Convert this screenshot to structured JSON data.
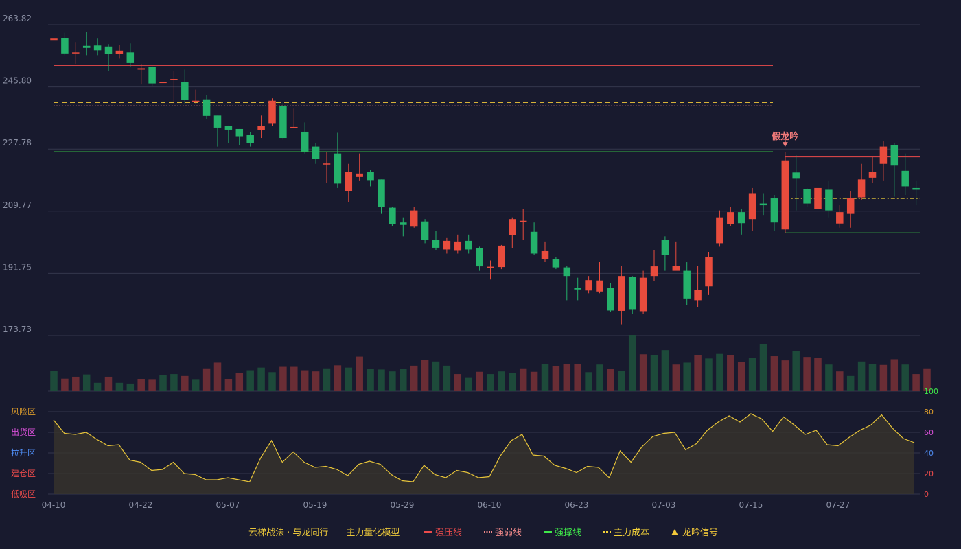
{
  "chart_data": {
    "type": "candlestick",
    "price_axis": {
      "ticks": [
        263.82,
        245.8,
        227.78,
        209.77,
        191.75,
        173.73
      ],
      "range": [
        173.73,
        263.82
      ]
    },
    "date_ticks": [
      "04-10",
      "04-22",
      "05-07",
      "05-19",
      "05-29",
      "06-10",
      "06-23",
      "07-03",
      "07-15",
      "07-27"
    ],
    "date_tick_index": [
      0,
      8,
      16,
      24,
      32,
      40,
      48,
      56,
      64,
      72
    ],
    "candles": [
      [
        259.8,
        259.2,
        260.6,
        255.1,
        "up"
      ],
      [
        260.0,
        255.5,
        261.5,
        255.0,
        "down"
      ],
      [
        255.8,
        255.6,
        258.8,
        252.5,
        "up"
      ],
      [
        257.1,
        257.7,
        261.8,
        255.0,
        "down"
      ],
      [
        257.8,
        256.4,
        259.8,
        255.0,
        "down"
      ],
      [
        257.5,
        255.4,
        258.2,
        250.5,
        "down"
      ],
      [
        256.3,
        255.4,
        258.0,
        254.0,
        "up"
      ],
      [
        255.8,
        252.7,
        258.4,
        251.6,
        "down"
      ],
      [
        251.2,
        250.8,
        252.5,
        246.5,
        "up"
      ],
      [
        251.5,
        246.8,
        251.8,
        245.9,
        "down"
      ],
      [
        247.1,
        247.2,
        251.0,
        243.2,
        "up"
      ],
      [
        248.1,
        248.0,
        250.5,
        241.0,
        "up"
      ],
      [
        247.2,
        242.0,
        250.8,
        241.0,
        "down"
      ],
      [
        241.5,
        241.8,
        245.0,
        241.0,
        "up"
      ],
      [
        242.2,
        237.4,
        243.5,
        236.5,
        "down"
      ],
      [
        237.5,
        234.0,
        237.5,
        228.5,
        "down"
      ],
      [
        234.4,
        233.4,
        234.6,
        229.5,
        "down"
      ],
      [
        233.6,
        231.5,
        233.6,
        229.0,
        "down"
      ],
      [
        231.8,
        229.6,
        232.8,
        228.5,
        "down"
      ],
      [
        233.2,
        234.4,
        237.5,
        231.0,
        "up"
      ],
      [
        235.3,
        241.8,
        242.5,
        234.5,
        "up"
      ],
      [
        240.2,
        231.0,
        241.5,
        230.5,
        "down"
      ],
      [
        234.2,
        234.0,
        239.5,
        234.0,
        "up"
      ],
      [
        232.8,
        227.1,
        235.5,
        226.5,
        "down"
      ],
      [
        228.5,
        225.0,
        229.5,
        223.5,
        "down"
      ],
      [
        223.4,
        223.6,
        227.0,
        218.0,
        "up"
      ],
      [
        226.5,
        217.8,
        232.5,
        216.5,
        "down"
      ],
      [
        215.5,
        221.2,
        223.5,
        212.5,
        "up"
      ],
      [
        220.7,
        219.7,
        226.5,
        218.5,
        "up"
      ],
      [
        221.2,
        218.6,
        221.8,
        217.0,
        "down"
      ],
      [
        219.0,
        211.0,
        219.0,
        209.0,
        "down"
      ],
      [
        210.8,
        206.0,
        211.0,
        205.5,
        "down"
      ],
      [
        206.5,
        205.8,
        208.0,
        202.5,
        "down"
      ],
      [
        205.3,
        210.0,
        211.0,
        205.0,
        "up"
      ],
      [
        206.8,
        201.5,
        207.5,
        200.5,
        "down"
      ],
      [
        201.5,
        199.2,
        204.0,
        198.5,
        "down"
      ],
      [
        201.2,
        198.7,
        202.0,
        197.5,
        "up"
      ],
      [
        198.3,
        201.0,
        203.0,
        197.5,
        "up"
      ],
      [
        201.2,
        198.7,
        203.0,
        197.5,
        "down"
      ],
      [
        199.0,
        193.8,
        199.5,
        192.5,
        "down"
      ],
      [
        193.7,
        193.3,
        195.5,
        190.0,
        "up"
      ],
      [
        193.6,
        199.8,
        200.0,
        193.0,
        "up"
      ],
      [
        202.8,
        207.5,
        208.0,
        199.0,
        "up"
      ],
      [
        207.0,
        207.0,
        210.5,
        201.5,
        "up"
      ],
      [
        203.8,
        197.5,
        206.5,
        197.0,
        "down"
      ],
      [
        196.0,
        198.2,
        201.0,
        195.0,
        "up"
      ],
      [
        195.8,
        193.5,
        196.5,
        193.0,
        "down"
      ],
      [
        193.5,
        191.0,
        194.0,
        184.0,
        "down"
      ],
      [
        187.1,
        187.5,
        190.5,
        184.0,
        "down"
      ],
      [
        186.8,
        189.8,
        191.0,
        186.0,
        "up"
      ],
      [
        189.7,
        186.5,
        195.0,
        186.0,
        "up"
      ],
      [
        181.0,
        187.5,
        189.0,
        180.5,
        "down"
      ],
      [
        180.9,
        191.0,
        194.0,
        177.0,
        "up"
      ],
      [
        190.8,
        181.2,
        191.0,
        180.0,
        "down"
      ],
      [
        180.8,
        190.5,
        192.5,
        180.0,
        "up"
      ],
      [
        191.0,
        193.8,
        198.5,
        189.5,
        "up"
      ],
      [
        197.0,
        201.5,
        202.5,
        192.5,
        "down"
      ],
      [
        192.5,
        194.0,
        201.0,
        193.0,
        "up"
      ],
      [
        192.5,
        184.5,
        195.0,
        182.5,
        "down"
      ],
      [
        184.0,
        187.0,
        194.0,
        182.0,
        "up"
      ],
      [
        188.0,
        196.5,
        198.0,
        185.5,
        "up"
      ],
      [
        200.5,
        208.0,
        210.0,
        199.5,
        "up"
      ],
      [
        206.0,
        209.5,
        211.0,
        205.5,
        "up"
      ],
      [
        206.3,
        209.5,
        210.5,
        203.0,
        "down"
      ],
      [
        207.5,
        215.0,
        216.5,
        204.0,
        "up"
      ],
      [
        211.5,
        212.0,
        215.0,
        208.5,
        "down"
      ],
      [
        206.5,
        213.5,
        214.5,
        204.0,
        "down"
      ],
      [
        204.5,
        224.5,
        227.0,
        203.5,
        "up"
      ],
      [
        221.0,
        219.2,
        226.0,
        210.0,
        "down"
      ],
      [
        216.2,
        212.0,
        216.5,
        211.0,
        "down"
      ],
      [
        210.5,
        216.5,
        220.5,
        205.5,
        "up"
      ],
      [
        216.0,
        210.0,
        218.5,
        208.0,
        "down"
      ],
      [
        209.5,
        206.2,
        211.5,
        205.0,
        "up"
      ],
      [
        209.0,
        213.5,
        215.5,
        205.0,
        "up"
      ],
      [
        213.8,
        219.0,
        223.5,
        213.0,
        "up"
      ],
      [
        219.5,
        221.2,
        225.5,
        218.0,
        "up"
      ],
      [
        223.5,
        228.5,
        230.0,
        218.5,
        "up"
      ],
      [
        229.0,
        223.0,
        229.5,
        214.0,
        "down"
      ],
      [
        221.5,
        217.0,
        226.5,
        214.5,
        "down"
      ],
      [
        216.0,
        216.5,
        218.5,
        211.5,
        "down"
      ]
    ],
    "volume": [
      54,
      33,
      38,
      44,
      22,
      38,
      22,
      20,
      32,
      30,
      42,
      45,
      40,
      30,
      60,
      75,
      32,
      48,
      55,
      62,
      50,
      64,
      64,
      55,
      52,
      60,
      68,
      62,
      91,
      59,
      57,
      52,
      58,
      67,
      82,
      78,
      67,
      45,
      35,
      51,
      45,
      52,
      48,
      60,
      51,
      71,
      65,
      71,
      71,
      50,
      70,
      58,
      54,
      148,
      97,
      95,
      108,
      70,
      75,
      95,
      86,
      98,
      95,
      77,
      88,
      124,
      92,
      81,
      106,
      90,
      88,
      70,
      52,
      40,
      78,
      72,
      69,
      84,
      70,
      45,
      60
    ],
    "volume_up": [
      0,
      1,
      1,
      0,
      0,
      1,
      0,
      0,
      1,
      1,
      0,
      0,
      1,
      0,
      1,
      1,
      1,
      1,
      0,
      0,
      0,
      1,
      1,
      1,
      1,
      0,
      1,
      0,
      1,
      0,
      0,
      0,
      0,
      1,
      1,
      0,
      0,
      1,
      0,
      1,
      0,
      0,
      0,
      1,
      1,
      0,
      1,
      1,
      1,
      0,
      0,
      1,
      0,
      0,
      1,
      0,
      0,
      1,
      0,
      1,
      0,
      0,
      1,
      1,
      0,
      0,
      1,
      1,
      0,
      1,
      1,
      0,
      1,
      0,
      0,
      0,
      1,
      1,
      0,
      1,
      1
    ],
    "zones": {
      "labels": [
        "风险区",
        "出货区",
        "拉升区",
        "建仓区",
        "低吸区"
      ],
      "colors": [
        "#d99a2b",
        "#d64fd6",
        "#4f8ef5",
        "#ec4b4b",
        "#ec4b4b"
      ]
    },
    "indicator_axis": {
      "ticks": [
        100,
        80,
        60,
        40,
        20,
        0
      ],
      "colors": [
        "#3fe84a",
        "#d99a2b",
        "#d64fd6",
        "#4f8ef5",
        "#ec4b4b",
        "#ec4b4b"
      ]
    },
    "indicator": [
      72,
      59,
      58,
      60,
      53,
      47,
      48,
      33,
      31,
      23,
      24,
      31,
      20,
      19,
      14,
      14,
      16,
      14,
      12,
      35,
      52,
      31,
      41,
      31,
      26,
      27,
      24,
      18,
      29,
      32,
      29,
      19,
      13,
      12,
      28,
      19,
      16,
      23,
      21,
      16,
      17,
      37,
      52,
      58,
      38,
      37,
      28,
      25,
      21,
      27,
      26,
      16,
      42,
      31,
      46,
      56,
      59,
      60,
      43,
      49,
      62,
      70,
      76,
      70,
      78,
      73,
      61,
      75,
      67,
      58,
      62,
      48,
      47,
      55,
      62,
      67,
      77,
      64,
      54,
      50
    ],
    "lines": {
      "resist": 252.0,
      "dash_orange": 241.3,
      "dash_pink": 240.3,
      "support": 227.0,
      "box_top": 225.5,
      "box_bottom": 203.5,
      "box_cost": 213.5
    },
    "annotation": {
      "text": "假龙吟",
      "index": 67
    },
    "legend": {
      "title": "云梯战法 · 与龙同行——主力量化模型",
      "items": [
        {
          "label": "强压线",
          "color": "#ec4b4b",
          "style": "solid"
        },
        {
          "label": "强弱线",
          "color": "#f28a8a",
          "style": "dotted"
        },
        {
          "label": "强撑线",
          "color": "#3fe84a",
          "style": "solid"
        },
        {
          "label": "主力成本",
          "color": "#f3d23a",
          "style": "dashed"
        },
        {
          "label": "龙吟信号",
          "color": "#f3c93a",
          "style": "triangle"
        }
      ]
    },
    "colors": {
      "up": "#e84c3d",
      "down": "#24b26b",
      "grid": "#34374c",
      "text": "#8a8fa3",
      "volume_up": "#6a2d35",
      "volume_down": "#1d4a3a"
    }
  }
}
